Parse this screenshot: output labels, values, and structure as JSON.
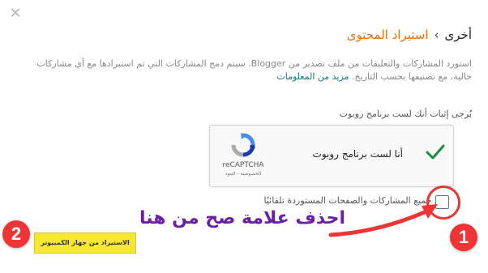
{
  "dialog": {
    "close_icon": "close-icon",
    "breadcrumb": {
      "parent": "أخرى",
      "separator": "›",
      "current": "استيراد المحتوى"
    },
    "description": {
      "text": "استورد المشاركات والتعليقات من ملف تصدير من Blogger. سيتم دمج المشاركات التي تم استيرادها مع أي مشاركات حالية، مع تصنيفها بحسب التاريخ.",
      "more_link": "مزيد من المعلومات"
    },
    "robot_prompt": "يُرجى إثبات أنك لست برنامج روبوت",
    "captcha": {
      "label": "أنا لست برنامج روبوت",
      "brand": "reCAPTCHA",
      "terms": "الخصوصية - البنود",
      "checked": true
    },
    "publish_checkbox": {
      "label": "نشر جميع المشاركات والصفحات المستوردة تلقائيًا",
      "checked": false
    },
    "import_button": "الاستيراد من جهاز الكمبيوتر"
  },
  "annotations": {
    "instruction": "احذف علامة صح من هنا",
    "badge_1": "1",
    "badge_2": "2",
    "highlight_color": "#ee3434",
    "instruction_color": "#6b1fa3"
  },
  "colors": {
    "accent": "#e8710a",
    "link": "#0f7a84",
    "check": "#1e8e3e",
    "button": "#f5e733"
  }
}
